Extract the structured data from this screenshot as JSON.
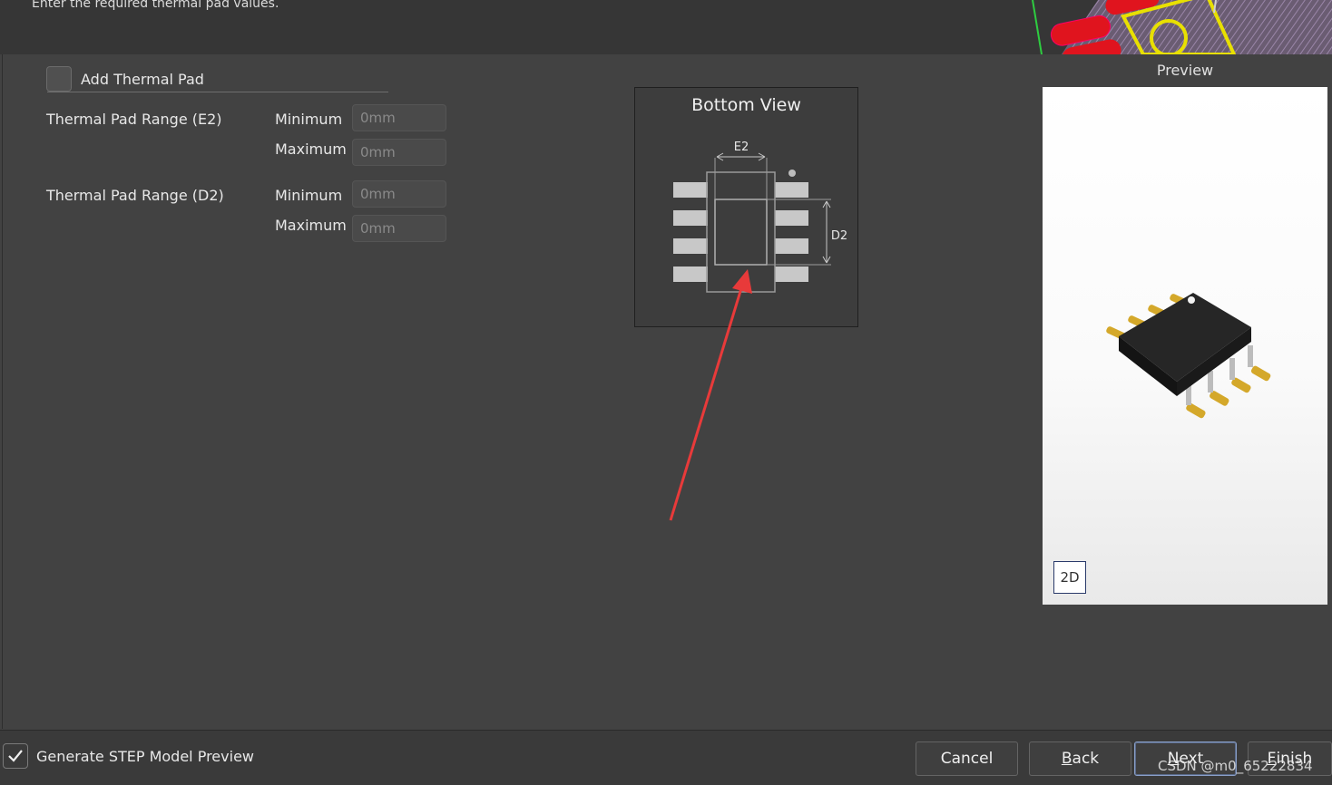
{
  "header": {
    "instruction": "Enter the required thermal pad values."
  },
  "thermal": {
    "add_label": "Add Thermal Pad",
    "add_checked": false,
    "e2_label": "Thermal Pad Range (E2)",
    "d2_label": "Thermal Pad Range (D2)",
    "min_label": "Minimum",
    "max_label": "Maximum",
    "e2_min": "0mm",
    "e2_max": "0mm",
    "d2_min": "0mm",
    "d2_max": "0mm"
  },
  "diagram": {
    "title": "Bottom View",
    "e2": "E2",
    "d2": "D2"
  },
  "preview": {
    "title": "Preview",
    "mode_button": "2D"
  },
  "footer": {
    "generate_label": "Generate STEP Model Preview",
    "generate_checked": true,
    "cancel": "Cancel",
    "back_mnemonic": "B",
    "back_rest": "ack",
    "next_mnemonic": "N",
    "next_rest": "ext",
    "finish_mnemonic": "F",
    "finish_rest": "inish"
  },
  "watermark": "CSDN @m0_65222834",
  "colors": {
    "annotation_arrow": "#e83a3a",
    "pcb_pad": "#e0141e",
    "pcb_outline": "#e8e000",
    "ic_body": "#1e1e1e",
    "ic_lead": "#d4a82a"
  }
}
